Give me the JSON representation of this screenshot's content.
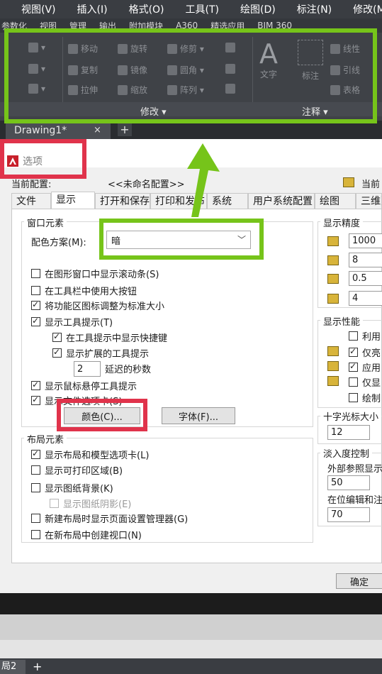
{
  "menubar": [
    "视图(V)",
    "插入(I)",
    "格式(O)",
    "工具(T)",
    "绘图(D)",
    "标注(N)",
    "修改(M)"
  ],
  "ribbon_tabs": [
    "参数化",
    "视图",
    "管理",
    "输出",
    "附加模块",
    "A360",
    "精选应用",
    "BIM 360"
  ],
  "ribbon": {
    "modify": {
      "move": "移动",
      "rotate": "旋转",
      "trim": "修剪",
      "copy": "复制",
      "mirror": "镜像",
      "fillet": "圆角",
      "stretch": "拉伸",
      "scale": "缩放",
      "array": "阵列",
      "panel_title": "修改 ▾"
    },
    "annotate": {
      "text": "文字",
      "dimension": "标注",
      "linear": "线性",
      "leader": "引线",
      "table": "表格",
      "panel_title": "注释 ▾"
    }
  },
  "doc_tab": {
    "label": "Drawing1*",
    "close": "×",
    "plus": "+"
  },
  "dialog": {
    "title": "选项",
    "current_profile_label": "当前配置:",
    "current_profile_value": "<<未命名配置>>",
    "current_drawing_label": "当前",
    "tabs": [
      "文件",
      "显示",
      "打开和保存",
      "打印和发布",
      "系统",
      "用户系统配置",
      "绘图",
      "三维建"
    ],
    "window_elements": {
      "title": "窗口元素",
      "color_scheme_label": "配色方案(M):",
      "color_scheme_value": "暗",
      "items": [
        {
          "label": "在图形窗口中显示滚动条(S)",
          "checked": false
        },
        {
          "label": "在工具栏中使用大按钮",
          "checked": false
        },
        {
          "label": "将功能区图标调整为标准大小",
          "checked": true
        },
        {
          "label": "显示工具提示(T)",
          "checked": true
        },
        {
          "label": "在工具提示中显示快捷键",
          "checked": true
        },
        {
          "label": "显示扩展的工具提示",
          "checked": true
        },
        {
          "label": "显示鼠标悬停工具提示",
          "checked": true
        },
        {
          "label": "显示文件选项卡(S)",
          "checked": true
        }
      ],
      "delay_value": "2",
      "delay_label": "延迟的秒数",
      "colors_button": "颜色(C)...",
      "fonts_button": "字体(F)..."
    },
    "layout_elements": {
      "title": "布局元素",
      "items": [
        {
          "label": "显示布局和模型选项卡(L)",
          "checked": true
        },
        {
          "label": "显示可打印区域(B)",
          "checked": false
        },
        {
          "label": "显示图纸背景(K)",
          "checked": false
        },
        {
          "label": "显示图纸阴影(E)",
          "checked": false,
          "disabled": true
        },
        {
          "label": "新建布局时显示页面设置管理器(G)",
          "checked": false
        },
        {
          "label": "在新布局中创建视口(N)",
          "checked": false
        }
      ]
    },
    "display_resolution": {
      "title": "显示精度",
      "values": [
        "1000",
        "8",
        "0.5",
        "4"
      ]
    },
    "display_performance": {
      "title": "显示性能",
      "items": [
        {
          "label": "利用",
          "checked": false
        },
        {
          "label": "仅亮",
          "checked": true
        },
        {
          "label": "应用",
          "checked": true
        },
        {
          "label": "仅显",
          "checked": false
        },
        {
          "label": "绘制",
          "checked": false
        }
      ]
    },
    "crosshair": {
      "title": "十字光标大小",
      "value": "12"
    },
    "fade": {
      "title": "淡入度控制",
      "xref_label": "外部参照显示",
      "xref_value": "50",
      "inplace_label": "在位编辑和注",
      "inplace_value": "70"
    },
    "ok_button": "确定"
  },
  "layout_bar": {
    "tab": "局2",
    "plus": "+"
  },
  "colors": {
    "highlight_green": "#76c41a",
    "highlight_red": "#e0334b"
  }
}
